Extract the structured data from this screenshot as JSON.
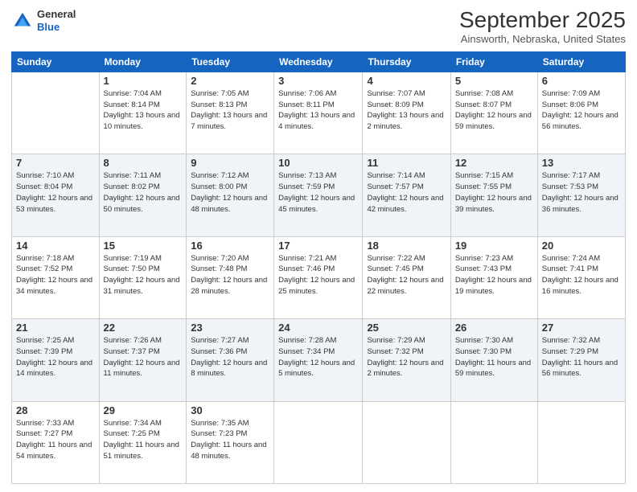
{
  "logo": {
    "line1": "General",
    "line2": "Blue"
  },
  "title": "September 2025",
  "location": "Ainsworth, Nebraska, United States",
  "weekdays": [
    "Sunday",
    "Monday",
    "Tuesday",
    "Wednesday",
    "Thursday",
    "Friday",
    "Saturday"
  ],
  "weeks": [
    [
      {
        "day": "",
        "sunrise": "",
        "sunset": "",
        "daylight": ""
      },
      {
        "day": "1",
        "sunrise": "Sunrise: 7:04 AM",
        "sunset": "Sunset: 8:14 PM",
        "daylight": "Daylight: 13 hours and 10 minutes."
      },
      {
        "day": "2",
        "sunrise": "Sunrise: 7:05 AM",
        "sunset": "Sunset: 8:13 PM",
        "daylight": "Daylight: 13 hours and 7 minutes."
      },
      {
        "day": "3",
        "sunrise": "Sunrise: 7:06 AM",
        "sunset": "Sunset: 8:11 PM",
        "daylight": "Daylight: 13 hours and 4 minutes."
      },
      {
        "day": "4",
        "sunrise": "Sunrise: 7:07 AM",
        "sunset": "Sunset: 8:09 PM",
        "daylight": "Daylight: 13 hours and 2 minutes."
      },
      {
        "day": "5",
        "sunrise": "Sunrise: 7:08 AM",
        "sunset": "Sunset: 8:07 PM",
        "daylight": "Daylight: 12 hours and 59 minutes."
      },
      {
        "day": "6",
        "sunrise": "Sunrise: 7:09 AM",
        "sunset": "Sunset: 8:06 PM",
        "daylight": "Daylight: 12 hours and 56 minutes."
      }
    ],
    [
      {
        "day": "7",
        "sunrise": "Sunrise: 7:10 AM",
        "sunset": "Sunset: 8:04 PM",
        "daylight": "Daylight: 12 hours and 53 minutes."
      },
      {
        "day": "8",
        "sunrise": "Sunrise: 7:11 AM",
        "sunset": "Sunset: 8:02 PM",
        "daylight": "Daylight: 12 hours and 50 minutes."
      },
      {
        "day": "9",
        "sunrise": "Sunrise: 7:12 AM",
        "sunset": "Sunset: 8:00 PM",
        "daylight": "Daylight: 12 hours and 48 minutes."
      },
      {
        "day": "10",
        "sunrise": "Sunrise: 7:13 AM",
        "sunset": "Sunset: 7:59 PM",
        "daylight": "Daylight: 12 hours and 45 minutes."
      },
      {
        "day": "11",
        "sunrise": "Sunrise: 7:14 AM",
        "sunset": "Sunset: 7:57 PM",
        "daylight": "Daylight: 12 hours and 42 minutes."
      },
      {
        "day": "12",
        "sunrise": "Sunrise: 7:15 AM",
        "sunset": "Sunset: 7:55 PM",
        "daylight": "Daylight: 12 hours and 39 minutes."
      },
      {
        "day": "13",
        "sunrise": "Sunrise: 7:17 AM",
        "sunset": "Sunset: 7:53 PM",
        "daylight": "Daylight: 12 hours and 36 minutes."
      }
    ],
    [
      {
        "day": "14",
        "sunrise": "Sunrise: 7:18 AM",
        "sunset": "Sunset: 7:52 PM",
        "daylight": "Daylight: 12 hours and 34 minutes."
      },
      {
        "day": "15",
        "sunrise": "Sunrise: 7:19 AM",
        "sunset": "Sunset: 7:50 PM",
        "daylight": "Daylight: 12 hours and 31 minutes."
      },
      {
        "day": "16",
        "sunrise": "Sunrise: 7:20 AM",
        "sunset": "Sunset: 7:48 PM",
        "daylight": "Daylight: 12 hours and 28 minutes."
      },
      {
        "day": "17",
        "sunrise": "Sunrise: 7:21 AM",
        "sunset": "Sunset: 7:46 PM",
        "daylight": "Daylight: 12 hours and 25 minutes."
      },
      {
        "day": "18",
        "sunrise": "Sunrise: 7:22 AM",
        "sunset": "Sunset: 7:45 PM",
        "daylight": "Daylight: 12 hours and 22 minutes."
      },
      {
        "day": "19",
        "sunrise": "Sunrise: 7:23 AM",
        "sunset": "Sunset: 7:43 PM",
        "daylight": "Daylight: 12 hours and 19 minutes."
      },
      {
        "day": "20",
        "sunrise": "Sunrise: 7:24 AM",
        "sunset": "Sunset: 7:41 PM",
        "daylight": "Daylight: 12 hours and 16 minutes."
      }
    ],
    [
      {
        "day": "21",
        "sunrise": "Sunrise: 7:25 AM",
        "sunset": "Sunset: 7:39 PM",
        "daylight": "Daylight: 12 hours and 14 minutes."
      },
      {
        "day": "22",
        "sunrise": "Sunrise: 7:26 AM",
        "sunset": "Sunset: 7:37 PM",
        "daylight": "Daylight: 12 hours and 11 minutes."
      },
      {
        "day": "23",
        "sunrise": "Sunrise: 7:27 AM",
        "sunset": "Sunset: 7:36 PM",
        "daylight": "Daylight: 12 hours and 8 minutes."
      },
      {
        "day": "24",
        "sunrise": "Sunrise: 7:28 AM",
        "sunset": "Sunset: 7:34 PM",
        "daylight": "Daylight: 12 hours and 5 minutes."
      },
      {
        "day": "25",
        "sunrise": "Sunrise: 7:29 AM",
        "sunset": "Sunset: 7:32 PM",
        "daylight": "Daylight: 12 hours and 2 minutes."
      },
      {
        "day": "26",
        "sunrise": "Sunrise: 7:30 AM",
        "sunset": "Sunset: 7:30 PM",
        "daylight": "Daylight: 11 hours and 59 minutes."
      },
      {
        "day": "27",
        "sunrise": "Sunrise: 7:32 AM",
        "sunset": "Sunset: 7:29 PM",
        "daylight": "Daylight: 11 hours and 56 minutes."
      }
    ],
    [
      {
        "day": "28",
        "sunrise": "Sunrise: 7:33 AM",
        "sunset": "Sunset: 7:27 PM",
        "daylight": "Daylight: 11 hours and 54 minutes."
      },
      {
        "day": "29",
        "sunrise": "Sunrise: 7:34 AM",
        "sunset": "Sunset: 7:25 PM",
        "daylight": "Daylight: 11 hours and 51 minutes."
      },
      {
        "day": "30",
        "sunrise": "Sunrise: 7:35 AM",
        "sunset": "Sunset: 7:23 PM",
        "daylight": "Daylight: 11 hours and 48 minutes."
      },
      {
        "day": "",
        "sunrise": "",
        "sunset": "",
        "daylight": ""
      },
      {
        "day": "",
        "sunrise": "",
        "sunset": "",
        "daylight": ""
      },
      {
        "day": "",
        "sunrise": "",
        "sunset": "",
        "daylight": ""
      },
      {
        "day": "",
        "sunrise": "",
        "sunset": "",
        "daylight": ""
      }
    ]
  ]
}
